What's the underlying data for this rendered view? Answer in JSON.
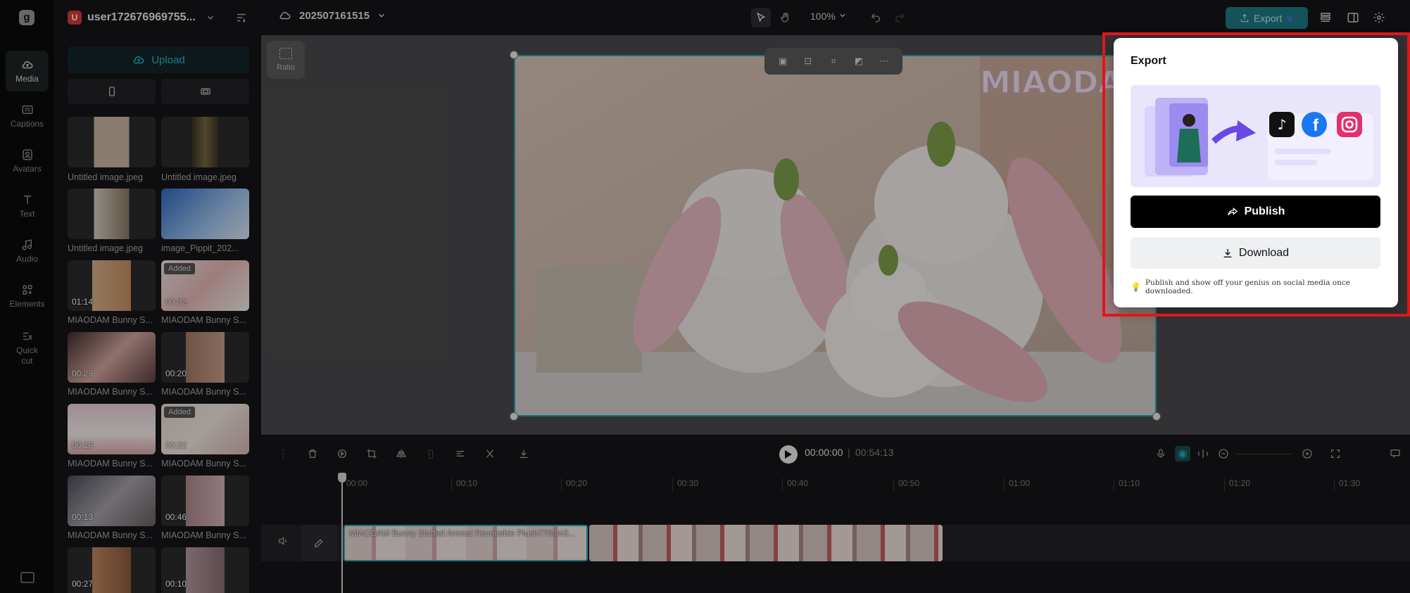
{
  "rail": {
    "items": [
      {
        "label": "Media",
        "icon": "cloud-icon"
      },
      {
        "label": "Captions",
        "icon": "captions-icon"
      },
      {
        "label": "Avatars",
        "icon": "avatar-icon"
      },
      {
        "label": "Text",
        "icon": "text-icon"
      },
      {
        "label": "Audio",
        "icon": "music-icon"
      },
      {
        "label": "Elements",
        "icon": "elements-icon"
      },
      {
        "label": "Quick\ncut",
        "icon": "quick-cut-icon"
      }
    ]
  },
  "panel": {
    "user_initial": "U",
    "user_name": "user172676969755...",
    "upload_label": "Upload",
    "items": [
      {
        "label": "Untitled image.jpeg",
        "duration": "",
        "added": ""
      },
      {
        "label": "Untitled image.jpeg",
        "duration": "",
        "added": ""
      },
      {
        "label": "Untitled image.jpeg",
        "duration": "",
        "added": ""
      },
      {
        "label": "image_Pippit_202...",
        "duration": "",
        "added": ""
      },
      {
        "label": "MIAODAM Bunny S...",
        "duration": "01:14",
        "added": ""
      },
      {
        "label": "MIAODAM Bunny S...",
        "duration": "00:32",
        "added": "Added"
      },
      {
        "label": "MIAODAM Bunny S...",
        "duration": "00:29",
        "added": ""
      },
      {
        "label": "MIAODAM Bunny S...",
        "duration": "00:20",
        "added": ""
      },
      {
        "label": "MIAODAM Bunny S...",
        "duration": "00:19",
        "added": ""
      },
      {
        "label": "MIAODAM Bunny S...",
        "duration": "00:22",
        "added": "Added"
      },
      {
        "label": "MIAODAM Bunny S...",
        "duration": "00:13",
        "added": ""
      },
      {
        "label": "MIAODAM Bunny S...",
        "duration": "00:46",
        "added": ""
      },
      {
        "label": "",
        "duration": "00:27",
        "added": ""
      },
      {
        "label": "",
        "duration": "00:10",
        "added": ""
      }
    ]
  },
  "topbar": {
    "project_name": "202507161515",
    "zoom": "100%",
    "export_label": "Export"
  },
  "stage": {
    "ratio_label": "Ratio",
    "watermark": "MIAODA"
  },
  "timeline": {
    "current_time": "00:00:00",
    "separator": "|",
    "total_time": "00:54:13",
    "ticks": [
      "00:00",
      "00:10",
      "00:20",
      "00:30",
      "00:40",
      "00:50",
      "01:00",
      "01:10",
      "01:20",
      "01:30"
    ],
    "clip_name": "MIAODAM Bunny Stuffed Animal Reversible Plush776l.m3..."
  },
  "export_popover": {
    "title": "Export",
    "publish_label": "Publish",
    "download_label": "Download",
    "tip": "Publish and show off your genius on social media once downloaded.",
    "highlight_color": "#e0161a"
  },
  "colors": {
    "accent": "#25aeb9",
    "export_button": "#1d7b84"
  }
}
